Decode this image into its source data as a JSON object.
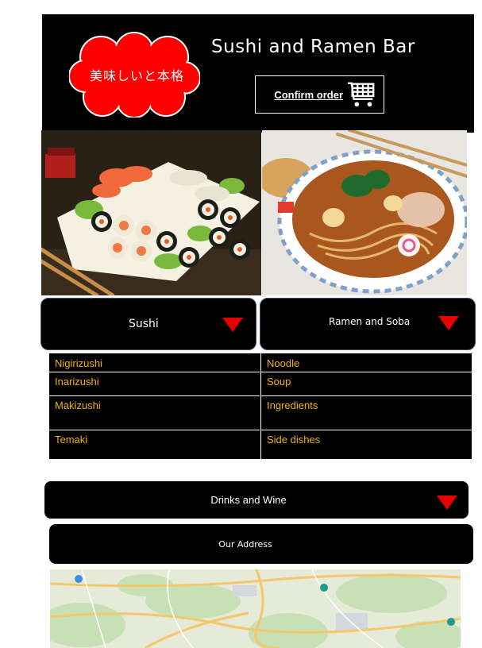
{
  "header": {
    "cloud_text": "美味しいと本格",
    "title": "Sushi and Ramen Bar",
    "confirm_label": "Confirm order",
    "cart_icon": "shopping-cart-icon"
  },
  "categories": {
    "sushi": {
      "label": "Sushi",
      "icon": "triangle-down-icon"
    },
    "ramen": {
      "label": "Ramen and Soba",
      "icon": "triangle-down-icon"
    }
  },
  "menu": {
    "sushi_items": [
      "Nigirizushi",
      "Inarizushi",
      "Makizushi",
      "Temaki"
    ],
    "ramen_items": [
      "Noodle",
      "Soup",
      "Ingredients",
      "Side dishes"
    ]
  },
  "drinks": {
    "label": "Drinks and Wine"
  },
  "address": {
    "label": "Our Address"
  },
  "colors": {
    "background": "#000000",
    "accent": "#e60000",
    "menu_text": "#f0b300",
    "text": "#ffffff"
  }
}
